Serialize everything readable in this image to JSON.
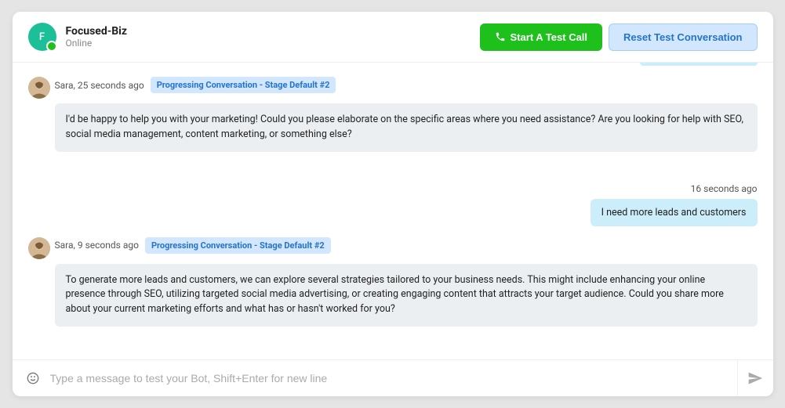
{
  "header": {
    "avatar_letter": "F",
    "name": "Focused-Biz",
    "status": "Online",
    "start_call_label": "Start A Test Call",
    "reset_label": "Reset Test Conversation"
  },
  "messages": [
    {
      "type": "bot",
      "author": "Sara",
      "time": "25 seconds ago",
      "stage": "Progressing Conversation - Stage Default #2",
      "text": "I'd be happy to help you with your marketing! Could you please elaborate on the specific areas where you need assistance? Are you looking for help with SEO, social media management, content marketing, or something else?"
    },
    {
      "type": "user",
      "time": "16 seconds ago",
      "text": "I need more leads and customers"
    },
    {
      "type": "bot",
      "author": "Sara",
      "time": "9 seconds ago",
      "stage": "Progressing Conversation - Stage Default #2",
      "text": "To generate more leads and customers, we can explore several strategies tailored to your business needs. This might include enhancing your online presence through SEO, utilizing targeted social media advertising, or creating engaging content that attracts your target audience. Could you share more about your current marketing efforts and what has or hasn't worked for you?"
    }
  ],
  "input": {
    "placeholder": "Type a message to test your Bot, Shift+Enter for new line"
  }
}
